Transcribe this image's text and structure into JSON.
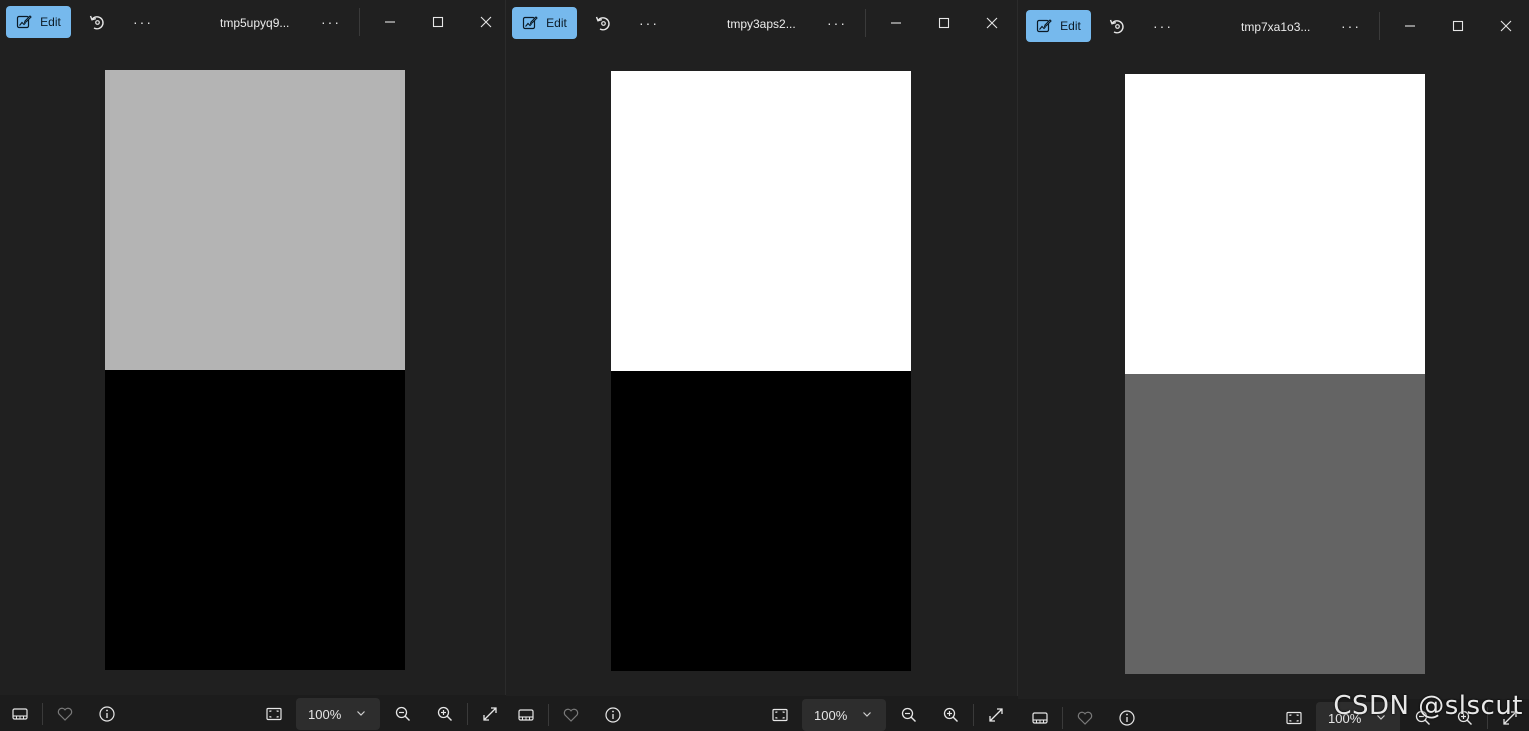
{
  "windows": [
    {
      "edit_label": "Edit",
      "filename": "tmp5upyq9...",
      "zoom": "100%",
      "top_color": "#b4b4b4",
      "bottom_color": "#000000"
    },
    {
      "edit_label": "Edit",
      "filename": "tmpy3aps2...",
      "zoom": "100%",
      "top_color": "#ffffff",
      "bottom_color": "#000000"
    },
    {
      "edit_label": "Edit",
      "filename": "tmp7xa1o3...",
      "zoom": "100%",
      "top_color": "#ffffff",
      "bottom_color": "#646464"
    }
  ],
  "dots_label": "···",
  "accent_color": "#76b9ed",
  "icons": [
    "edit-image-icon",
    "rotate-icon",
    "more-icon",
    "minimize-icon",
    "maximize-icon",
    "close-icon",
    "filmstrip-icon",
    "favorite-icon",
    "info-icon",
    "fit-to-window-icon",
    "chevron-down-icon",
    "zoom-out-icon",
    "zoom-in-icon",
    "full-screen-icon"
  ],
  "watermark": "CSDN @slscut"
}
